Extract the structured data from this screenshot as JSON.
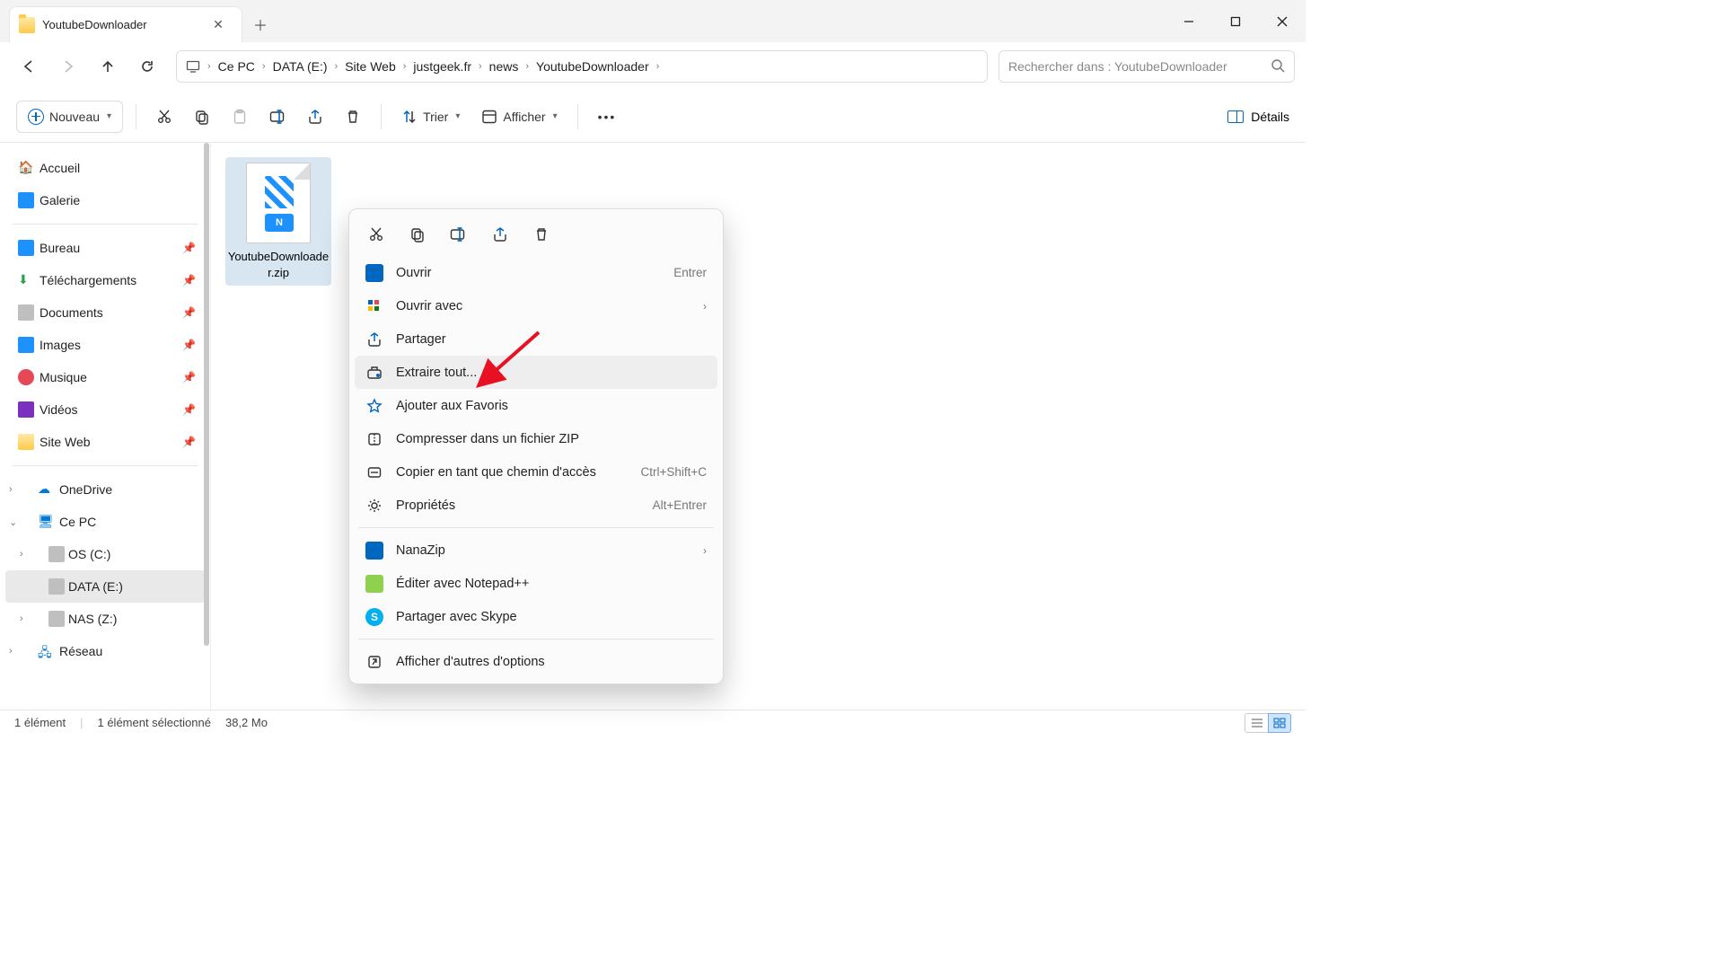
{
  "window": {
    "tab_title": "YoutubeDownloader"
  },
  "breadcrumbs": [
    "Ce PC",
    "DATA (E:)",
    "Site Web",
    "justgeek.fr",
    "news",
    "YoutubeDownloader"
  ],
  "search": {
    "placeholder": "Rechercher dans : YoutubeDownloader"
  },
  "toolbar": {
    "new_label": "Nouveau",
    "sort_label": "Trier",
    "view_label": "Afficher",
    "details_label": "Détails"
  },
  "sidebar": {
    "top": [
      {
        "label": "Accueil",
        "icon": "home"
      },
      {
        "label": "Galerie",
        "icon": "gallery"
      }
    ],
    "quick": [
      {
        "label": "Bureau",
        "icon": "desktop"
      },
      {
        "label": "Téléchargements",
        "icon": "downloads"
      },
      {
        "label": "Documents",
        "icon": "documents"
      },
      {
        "label": "Images",
        "icon": "images"
      },
      {
        "label": "Musique",
        "icon": "music"
      },
      {
        "label": "Vidéos",
        "icon": "videos"
      },
      {
        "label": "Site Web",
        "icon": "folder"
      }
    ],
    "tree": {
      "onedrive": "OneDrive",
      "thispc": "Ce PC",
      "drives": [
        {
          "label": "OS (C:)"
        },
        {
          "label": "DATA (E:)",
          "selected": true
        },
        {
          "label": "NAS (Z:)"
        }
      ],
      "network": "Réseau"
    }
  },
  "file": {
    "name": "YoutubeDownloader.zip",
    "tag": "N"
  },
  "context_menu": {
    "items": [
      {
        "label": "Ouvrir",
        "shortcut": "Entrer",
        "icon": "open"
      },
      {
        "label": "Ouvrir avec",
        "submenu": true,
        "icon": "openwith"
      },
      {
        "label": "Partager",
        "icon": "share"
      },
      {
        "label": "Extraire tout...",
        "icon": "extract",
        "highlighted": true
      },
      {
        "label": "Ajouter aux Favoris",
        "icon": "star"
      },
      {
        "label": "Compresser dans un fichier ZIP",
        "icon": "zip"
      },
      {
        "label": "Copier en tant que chemin d'accès",
        "shortcut": "Ctrl+Shift+C",
        "icon": "copypath"
      },
      {
        "label": "Propriétés",
        "shortcut": "Alt+Entrer",
        "icon": "properties"
      }
    ],
    "items2": [
      {
        "label": "NanaZip",
        "submenu": true,
        "icon": "nanazip"
      },
      {
        "label": "Éditer avec Notepad++",
        "icon": "notepadpp"
      },
      {
        "label": "Partager avec Skype",
        "icon": "skype"
      }
    ],
    "more": "Afficher d'autres d'options"
  },
  "status": {
    "count": "1 élément",
    "selection": "1 élément sélectionné",
    "size": "38,2 Mo"
  }
}
